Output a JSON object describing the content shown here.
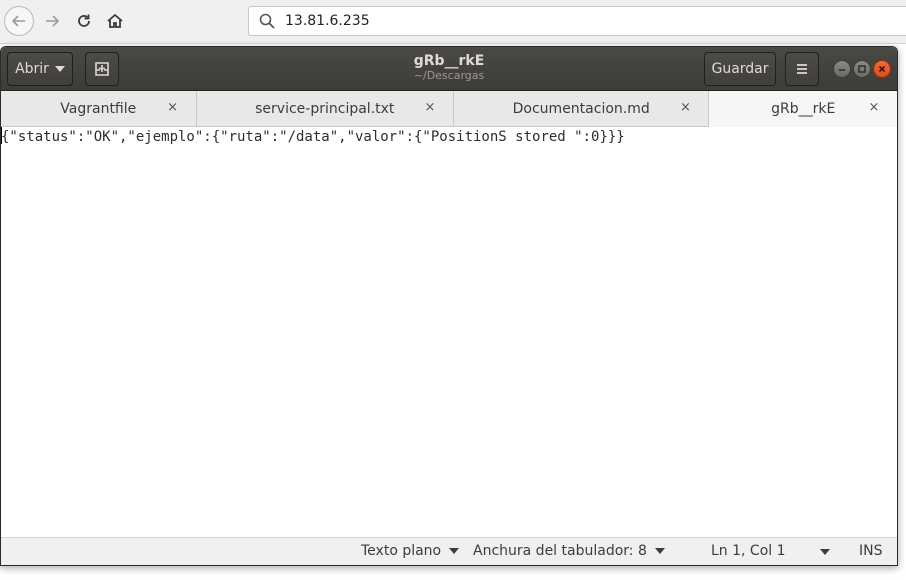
{
  "browser": {
    "url": "13.81.6.235",
    "icons": [
      "arrow-left-icon",
      "arrow-right-icon",
      "reload-icon",
      "home-icon",
      "search-icon"
    ]
  },
  "header": {
    "open_label": "Abrir",
    "save_label": "Guardar",
    "title": "gRb__rkE",
    "subtitle": "~/Descargas",
    "colors": {
      "header_bg": "#3d3c38",
      "close_button": "#e0541f"
    }
  },
  "tabs": [
    {
      "label": "Vagrantfile",
      "active": false
    },
    {
      "label": "service-principal.txt",
      "active": false
    },
    {
      "label": "Documentacion.md",
      "active": false
    },
    {
      "label": "gRb__rkE",
      "active": true
    }
  ],
  "tab_close_glyph": "×",
  "editor": {
    "content": "{\"status\":\"OK\",\"ejemplo\":{\"ruta\":\"/data\",\"valor\":{\"PositionS stored \":0}}}"
  },
  "statusbar": {
    "language": "Texto plano",
    "tab_width": "Anchura del tabulador: 8",
    "position": "Ln 1, Col 1",
    "mode": "INS"
  }
}
